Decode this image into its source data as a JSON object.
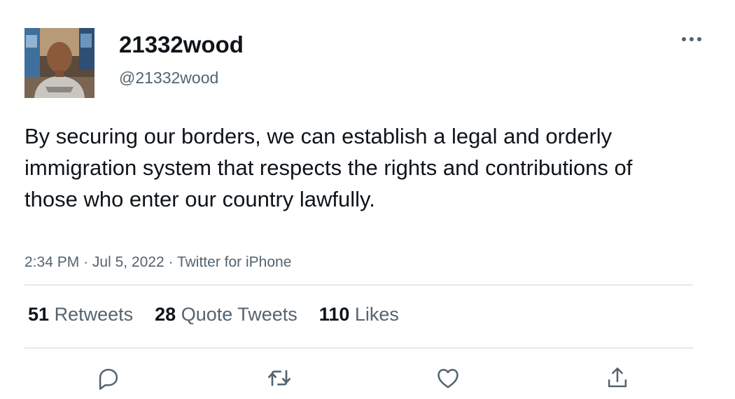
{
  "user": {
    "display_name": "21332wood",
    "handle": "@21332wood"
  },
  "tweet": {
    "text": "By securing our borders, we can establish a legal and orderly immigration system that respects the rights and contributions of those who enter our country lawfully.",
    "time": "2:34 PM",
    "separator": "·",
    "date": "Jul 5, 2022",
    "source": "Twitter for iPhone"
  },
  "stats": {
    "retweets": {
      "count": "51",
      "label": "Retweets"
    },
    "quote_tweets": {
      "count": "28",
      "label": "Quote Tweets"
    },
    "likes": {
      "count": "110",
      "label": "Likes"
    }
  },
  "icons": {
    "more": "more-horizontal-icon",
    "reply": "reply-icon",
    "retweet": "retweet-icon",
    "like": "heart-icon",
    "share": "share-icon"
  },
  "colors": {
    "text_primary": "#0f1419",
    "text_secondary": "#536471",
    "divider": "#e6e8ea",
    "icon": "#536471"
  }
}
